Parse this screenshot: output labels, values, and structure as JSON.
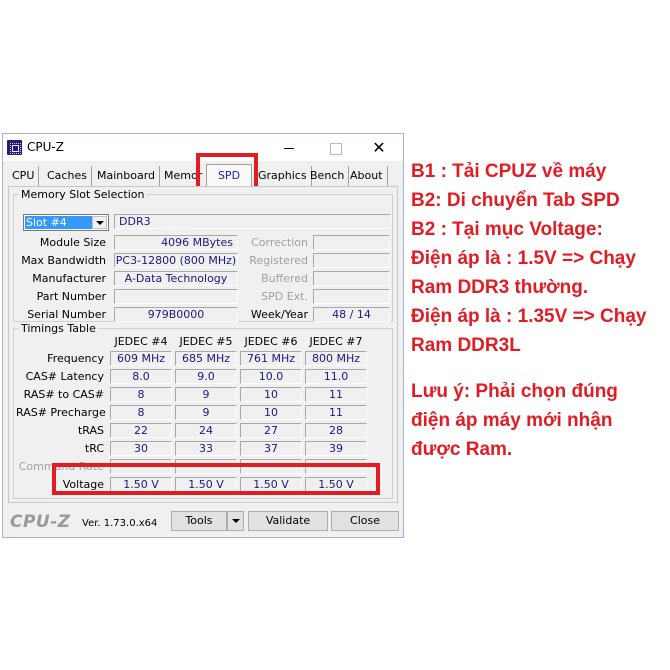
{
  "window": {
    "title": "CPU-Z",
    "controls": {
      "minimize": "minimize",
      "maximize": "maximize",
      "close": "✕"
    }
  },
  "tabs": [
    {
      "label": "CPU"
    },
    {
      "label": "Caches"
    },
    {
      "label": "Mainboard"
    },
    {
      "label": "Memor"
    },
    {
      "label": "SPD",
      "active": true
    },
    {
      "label": "Graphics"
    },
    {
      "label": "Bench"
    },
    {
      "label": "About"
    }
  ],
  "memory_slot": {
    "group_title": "Memory Slot Selection",
    "slot_selected": "Slot #4",
    "memory_type": "DDR3",
    "fields": {
      "module_size": {
        "label": "Module Size",
        "value": "4096 MBytes"
      },
      "max_bandwidth": {
        "label": "Max Bandwidth",
        "value": "PC3-12800 (800 MHz)"
      },
      "manufacturer": {
        "label": "Manufacturer",
        "value": "A-Data Technology"
      },
      "part_number": {
        "label": "Part Number",
        "value": ""
      },
      "serial_number": {
        "label": "Serial Number",
        "value": "979B0000"
      },
      "correction": {
        "label": "Correction",
        "value": ""
      },
      "registered": {
        "label": "Registered",
        "value": ""
      },
      "buffered": {
        "label": "Buffered",
        "value": ""
      },
      "spd_ext": {
        "label": "SPD Ext.",
        "value": ""
      },
      "week_year": {
        "label": "Week/Year",
        "value": "48 / 14"
      }
    }
  },
  "timings": {
    "group_title": "Timings Table",
    "columns": [
      "JEDEC #4",
      "JEDEC #5",
      "JEDEC #6",
      "JEDEC #7"
    ],
    "rows": [
      {
        "label": "Frequency",
        "values": [
          "609 MHz",
          "685 MHz",
          "761 MHz",
          "800 MHz"
        ]
      },
      {
        "label": "CAS# Latency",
        "values": [
          "8.0",
          "9.0",
          "10.0",
          "11.0"
        ]
      },
      {
        "label": "RAS# to CAS#",
        "values": [
          "8",
          "9",
          "10",
          "11"
        ]
      },
      {
        "label": "RAS# Precharge",
        "values": [
          "8",
          "9",
          "10",
          "11"
        ]
      },
      {
        "label": "tRAS",
        "values": [
          "22",
          "24",
          "27",
          "28"
        ]
      },
      {
        "label": "tRC",
        "values": [
          "30",
          "33",
          "37",
          "39"
        ]
      },
      {
        "label": "Command Rate",
        "values": [
          "",
          "",
          "",
          ""
        ]
      },
      {
        "label": "Voltage",
        "values": [
          "1.50 V",
          "1.50 V",
          "1.50 V",
          "1.50 V"
        ]
      }
    ]
  },
  "footer": {
    "logo": "CPU-Z",
    "version": "Ver. 1.73.0.x64",
    "tools_label": "Tools",
    "validate_label": "Validate",
    "close_label": "Close"
  },
  "instructions": {
    "color": "#e31b23",
    "lines": [
      "B1 : Tải CPUZ về máy",
      "B2: Di chuyển Tab SPD",
      "B2 : Tại mục Voltage:",
      "Điện áp là : 1.5V => Chạy",
      "Ram DDR3 thường.",
      "Điện áp là : 1.35V => Chạy",
      "Ram DDR3L"
    ],
    "note_lines": [
      "Lưu ý: Phải chọn đúng",
      "điện áp máy mới nhận",
      "được Ram."
    ]
  }
}
